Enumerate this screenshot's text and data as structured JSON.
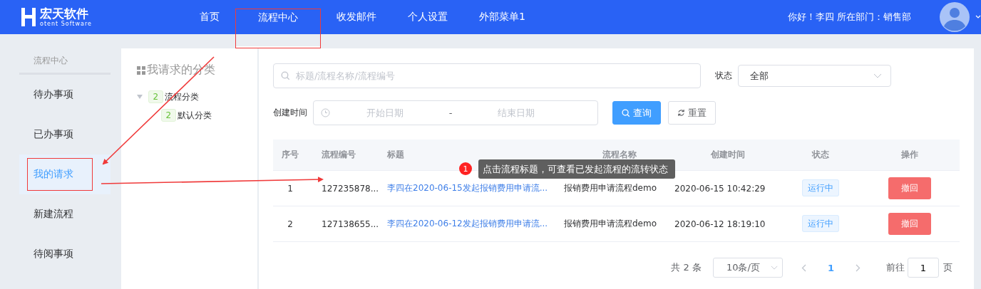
{
  "header": {
    "logo_title": "宏天软件",
    "logo_subtitle": "otent Software",
    "nav": [
      {
        "label": "首页",
        "selected": false,
        "highlighted": false
      },
      {
        "label": "流程中心",
        "selected": true,
        "highlighted": true
      },
      {
        "label": "收发邮件",
        "selected": false,
        "highlighted": false
      },
      {
        "label": "个人设置",
        "selected": false,
        "highlighted": false
      },
      {
        "label": "外部菜单1",
        "selected": false,
        "highlighted": false
      }
    ],
    "greeting": "你好！李四",
    "department": "所在部门：销售部"
  },
  "sidebar": {
    "title": "流程中心",
    "items": [
      {
        "label": "待办事项",
        "selected": false,
        "highlighted": false
      },
      {
        "label": "已办事项",
        "selected": false,
        "highlighted": false
      },
      {
        "label": "我的请求",
        "selected": true,
        "highlighted": true
      },
      {
        "label": "新建流程",
        "selected": false,
        "highlighted": false
      },
      {
        "label": "待阅事项",
        "selected": false,
        "highlighted": false
      }
    ]
  },
  "tree": {
    "title": "我请求的分类",
    "nodes": [
      {
        "label": "流程分类",
        "count": "2",
        "expanded": true,
        "children": [
          {
            "label": "默认分类",
            "count": "2"
          }
        ]
      }
    ]
  },
  "filters": {
    "search": {
      "placeholder": "标题/流程名称/流程编号"
    },
    "status_label": "状态",
    "status_value": "全部",
    "created_label": "创建时间",
    "start_placeholder": "开始日期",
    "range_separator": "-",
    "end_placeholder": "结束日期",
    "search_button": "查询",
    "reset_button": "重置"
  },
  "table": {
    "columns": [
      "序号",
      "流程编号",
      "标题",
      "流程名称",
      "创建时间",
      "状态",
      "操作"
    ],
    "rows": [
      {
        "index": "1",
        "number": "127235878...",
        "title": "李四在2020-06-15发起报销费用申请流...",
        "process": "报销费用申请流程demo",
        "created": "2020-06-15 10:42:29",
        "status": "运行中",
        "action": "撤回"
      },
      {
        "index": "2",
        "number": "127138655...",
        "title": "李四在2020-06-12发起报销费用申请流...",
        "process": "报销费用申请流程demo",
        "created": "2020-06-12 18:19:10",
        "status": "运行中",
        "action": "撤回"
      }
    ]
  },
  "tooltip": {
    "badge": "1",
    "text": "点击流程标题，可查看已发起流程的流转状态"
  },
  "pagination": {
    "total": "共 2 条",
    "page_size": "10条/页",
    "pages": [
      {
        "label": "1",
        "selected": true
      }
    ],
    "goto_label": "前往",
    "goto_value": "1",
    "goto_suffix": "页"
  }
}
